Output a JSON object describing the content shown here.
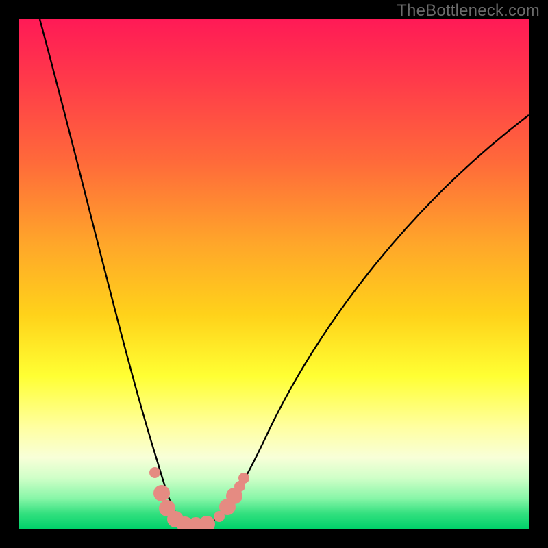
{
  "watermark": "TheBottleneck.com",
  "chart_data": {
    "type": "line",
    "title": "",
    "xlabel": "",
    "ylabel": "",
    "xlim": [
      0,
      100
    ],
    "ylim": [
      0,
      100
    ],
    "series": [
      {
        "name": "curve",
        "x": [
          4,
          8,
          12,
          16,
          20,
          24,
          26,
          28,
          30,
          32,
          34,
          37,
          40,
          44,
          50,
          58,
          66,
          74,
          82,
          90,
          100
        ],
        "y": [
          100,
          84,
          68,
          52,
          36,
          18,
          10,
          4,
          1,
          0,
          0,
          0,
          1,
          3,
          8,
          18,
          32,
          48,
          62,
          74,
          82
        ]
      }
    ],
    "markers": {
      "name": "salmon-dots",
      "color": "#e58b82",
      "points": [
        {
          "x": 26,
          "y": 10,
          "r": 1.1
        },
        {
          "x": 27,
          "y": 6,
          "r": 1.6
        },
        {
          "x": 28,
          "y": 3,
          "r": 1.6
        },
        {
          "x": 30,
          "y": 0.8,
          "r": 1.6
        },
        {
          "x": 32,
          "y": 0.4,
          "r": 1.6
        },
        {
          "x": 34,
          "y": 0.4,
          "r": 1.6
        },
        {
          "x": 36,
          "y": 0.5,
          "r": 1.6
        },
        {
          "x": 39,
          "y": 1.5,
          "r": 1.1
        },
        {
          "x": 40.5,
          "y": 3,
          "r": 1.6
        },
        {
          "x": 42,
          "y": 5,
          "r": 1.6
        },
        {
          "x": 43,
          "y": 7,
          "r": 1.1
        },
        {
          "x": 44,
          "y": 9,
          "r": 1.1
        }
      ]
    },
    "background_gradient": {
      "top": "#ff1a56",
      "mid": "#ffff33",
      "bottom": "#00d26a"
    }
  }
}
